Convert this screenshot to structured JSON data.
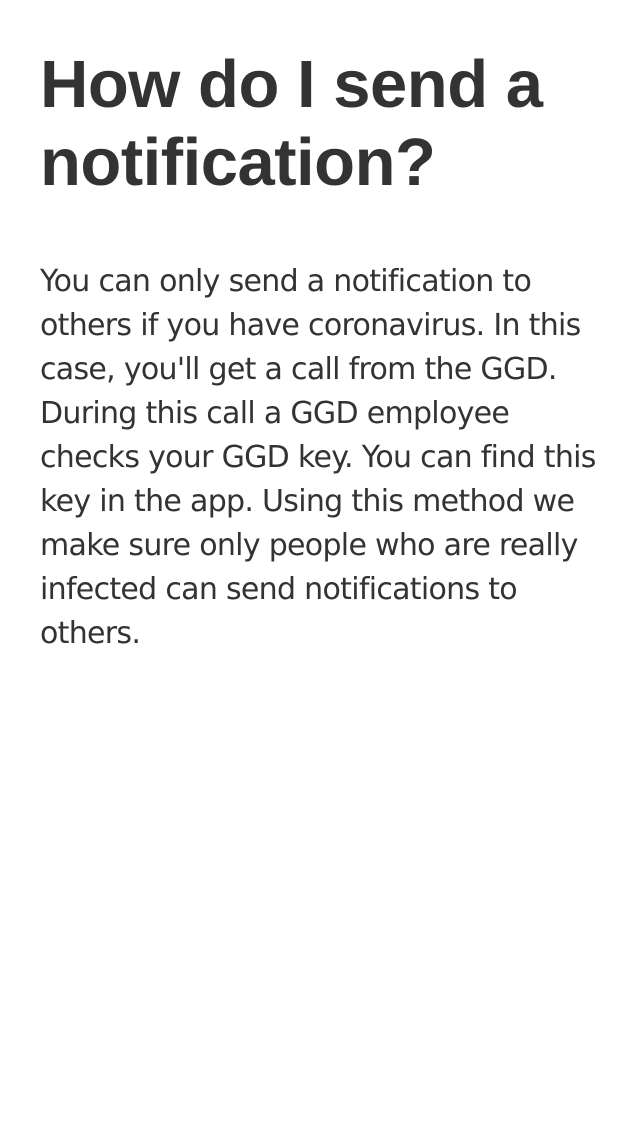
{
  "page": {
    "title": "How do I send a notification?",
    "body": "You can only send a notification to others if you have coronavirus. In this case, you'll get a call from the GGD. During this call a GGD employee checks your GGD key. You can find this key in the app. Using this method we make sure only people who are really infected can send notifications to others."
  }
}
